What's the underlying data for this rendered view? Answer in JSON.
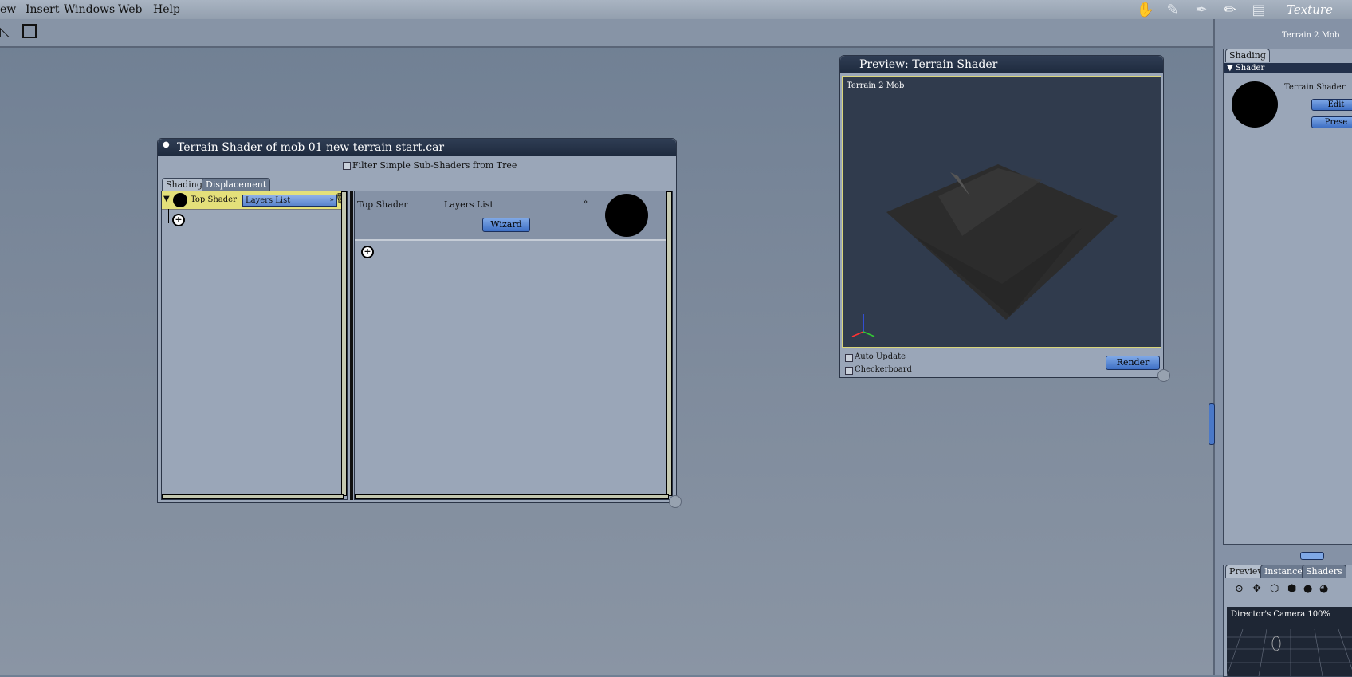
{
  "menu": [
    "ew",
    "Insert",
    "Windows",
    "Web",
    "Help"
  ],
  "rooms": {
    "label": "Texture",
    "icons": [
      "hand-icon",
      "brush-icon",
      "pen-icon",
      "pencil-icon",
      "film-icon"
    ]
  },
  "toolbar": {
    "icons": [
      "line-select-icon",
      "transform-box-icon"
    ]
  },
  "shader_window": {
    "title": "Terrain Shader of mob 01 new terrain start.car",
    "filter_label": "Filter Simple Sub-Shaders from Tree",
    "tabs": [
      "Shading",
      "Displacement"
    ],
    "tree_node": {
      "label": "Top Shader",
      "dropdown": "Layers List"
    },
    "detail": {
      "name": "Top Shader",
      "type": "Layers List",
      "wizard": "Wizard"
    }
  },
  "preview_window": {
    "title": "Preview: Terrain Shader",
    "object_label": "Terrain 2 Mob",
    "auto_update": "Auto Update",
    "checkerboard": "Checkerboard",
    "render": "Render"
  },
  "right_panel": {
    "object": "Terrain 2 Mob",
    "tab": "Shading",
    "section": "Shader",
    "shader_name": "Terrain Shader",
    "edit": "Edit",
    "presets": "Prese",
    "bottom_tabs": [
      "Preview",
      "Instances",
      "Shaders"
    ],
    "camera_label": "Director's Camera 100%"
  }
}
